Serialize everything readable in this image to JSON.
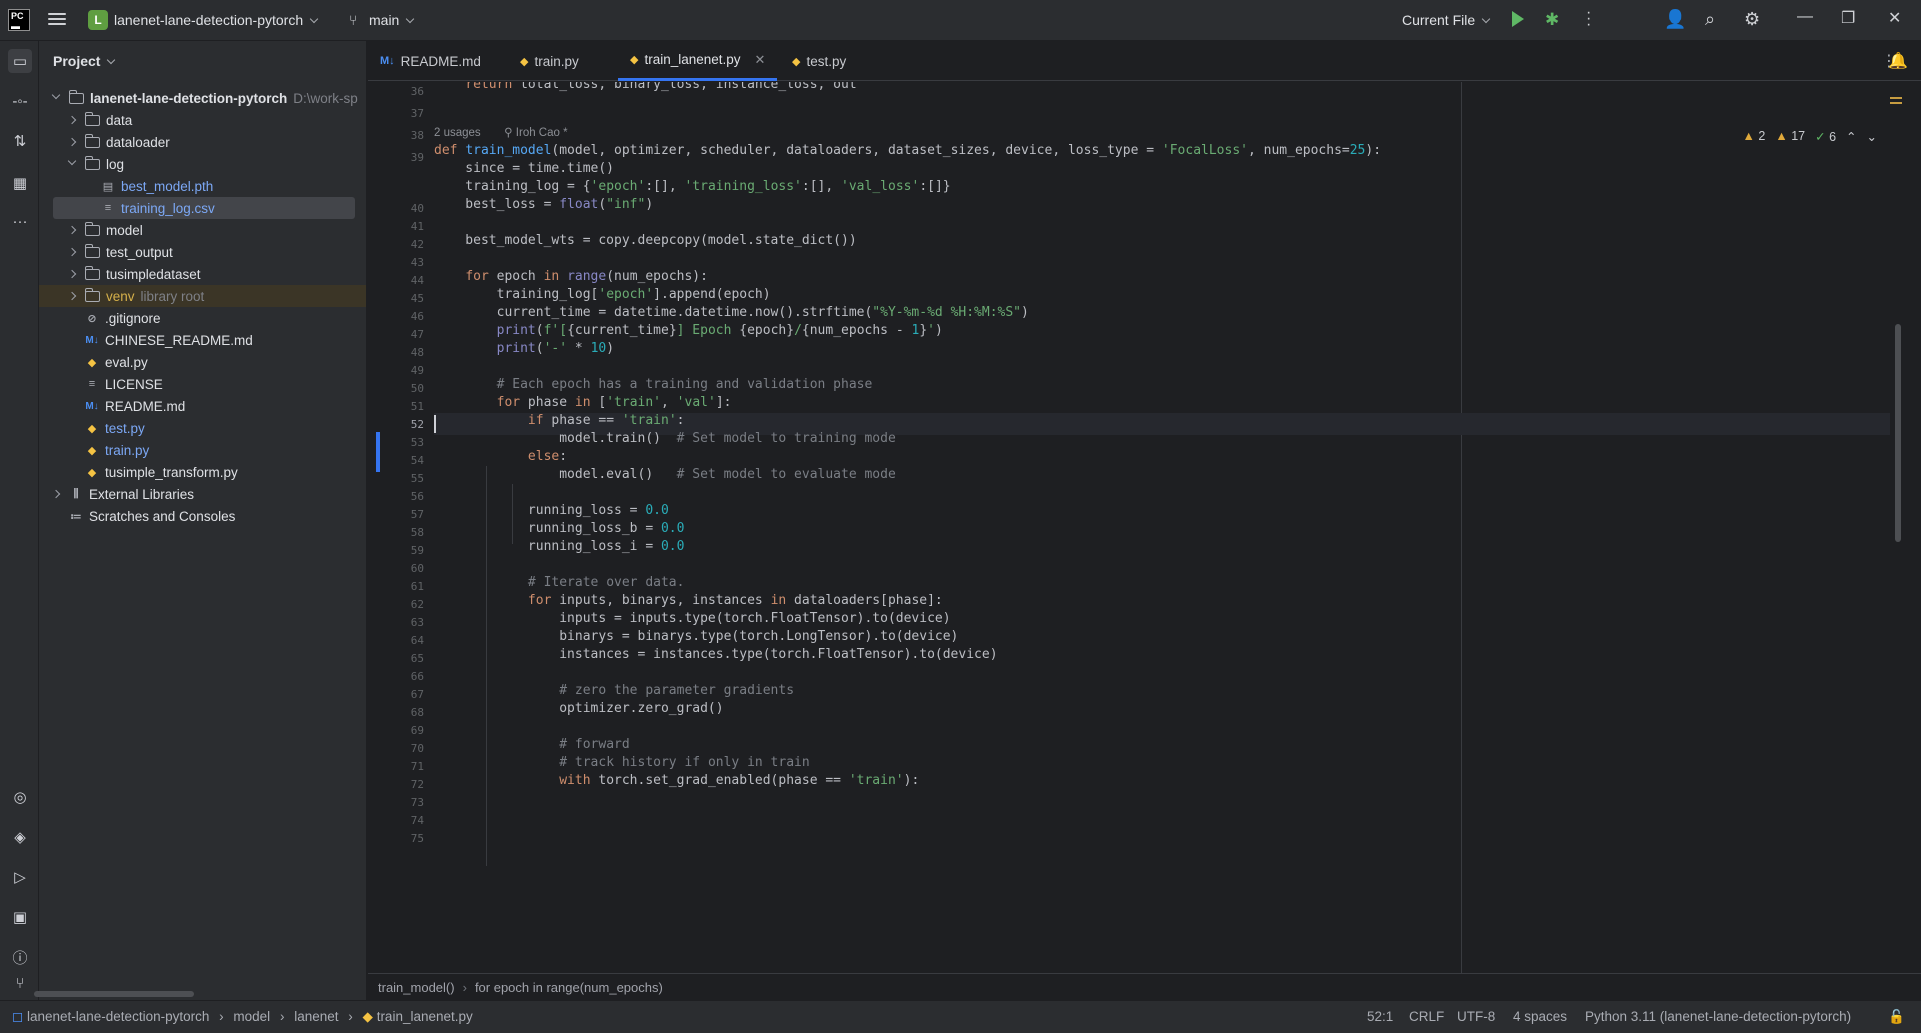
{
  "titlebar": {
    "project_badge": "L",
    "project_name": "lanenet-lane-detection-pytorch",
    "branch": "main",
    "run_config": "Current File"
  },
  "project_panel": {
    "title": "Project",
    "root_name": "lanenet-lane-detection-pytorch",
    "root_path": "D:\\work-sp",
    "items": [
      {
        "label": "data"
      },
      {
        "label": "dataloader"
      },
      {
        "label": "log"
      },
      {
        "label": "best_model.pth"
      },
      {
        "label": "training_log.csv"
      },
      {
        "label": "model"
      },
      {
        "label": "test_output"
      },
      {
        "label": "tusimpledataset"
      },
      {
        "label": "venv",
        "suffix": "library root"
      },
      {
        "label": ".gitignore"
      },
      {
        "label": "CHINESE_README.md"
      },
      {
        "label": "eval.py"
      },
      {
        "label": "LICENSE"
      },
      {
        "label": "README.md"
      },
      {
        "label": "test.py"
      },
      {
        "label": "train.py"
      },
      {
        "label": "tusimple_transform.py"
      },
      {
        "label": "External Libraries"
      },
      {
        "label": "Scratches and Consoles"
      }
    ]
  },
  "tabs": [
    {
      "label": "README.md",
      "icon": "M↓"
    },
    {
      "label": "train.py",
      "icon": "py"
    },
    {
      "label": "train_lanenet.py",
      "icon": "py",
      "active": true
    },
    {
      "label": "test.py",
      "icon": "py"
    }
  ],
  "editor": {
    "inspections": {
      "warnings": "2",
      "weak_warnings": "17",
      "ok": "6"
    },
    "usage_hint": "2 usages",
    "author_hint": "Iroh Cao *",
    "line_numbers": [
      "36",
      "37",
      "38",
      "39",
      "",
      "40",
      "41",
      "42",
      "43",
      "44",
      "45",
      "46",
      "47",
      "48",
      "49",
      "50",
      "51",
      "52",
      "53",
      "54",
      "55",
      "56",
      "57",
      "58",
      "59",
      "60",
      "61",
      "62",
      "63",
      "64",
      "65",
      "66",
      "67",
      "68",
      "69",
      "70",
      "71",
      "72",
      "73",
      "74",
      "75"
    ]
  },
  "breadcrumb_bar": {
    "items": [
      "train_model()",
      "for epoch in range(num_epochs)"
    ]
  },
  "statusbar": {
    "path": [
      "lanenet-lane-detection-pytorch",
      "model",
      "lanenet",
      "train_lanenet.py"
    ],
    "position": "52:1",
    "line_sep": "CRLF",
    "encoding": "UTF-8",
    "indent": "4 spaces",
    "interpreter": "Python 3.11 (lanenet-lane-detection-pytorch)"
  }
}
